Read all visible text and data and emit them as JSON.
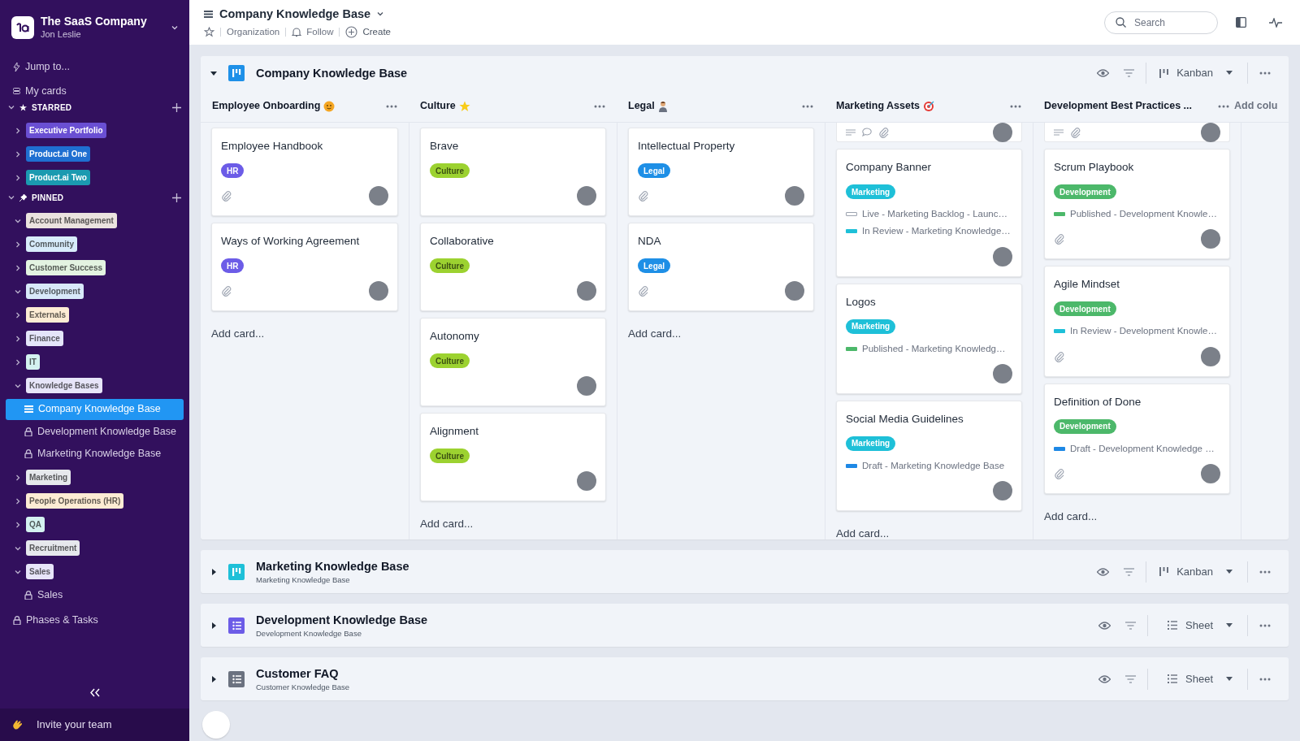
{
  "sidebar": {
    "org": "The SaaS Company",
    "user": "Jon Leslie",
    "nav": [
      {
        "label": "Jump to...",
        "kind": "jump"
      },
      {
        "label": "My cards",
        "kind": "cards"
      }
    ],
    "groups": [
      {
        "title": "STARRED",
        "kind": "star",
        "expanded": true,
        "items": [
          {
            "label": "Executive Portfolio",
            "color": "#6a4fd3",
            "expanded": false
          },
          {
            "label": "Product.ai One",
            "color": "#1f6fd1",
            "expanded": false
          },
          {
            "label": "Product.ai Two",
            "color": "#1b9ab0",
            "expanded": false
          }
        ]
      },
      {
        "title": "PINNED",
        "kind": "pin",
        "expanded": true,
        "items": [
          {
            "label": "Account Management",
            "color": "#ebe3df",
            "expanded": true
          },
          {
            "label": "Community",
            "color": "#d8ecfb",
            "expanded": false
          },
          {
            "label": "Customer Success",
            "color": "#e3f3e1",
            "expanded": false
          },
          {
            "label": "Development",
            "color": "#d8e9f9",
            "expanded": true
          },
          {
            "label": "Externals",
            "color": "#fdecd4",
            "expanded": false
          },
          {
            "label": "Finance",
            "color": "#e4e5f9",
            "expanded": false
          },
          {
            "label": "IT",
            "color": "#d4f2f0",
            "expanded": false
          },
          {
            "label": "Knowledge Bases",
            "color": "#e7e5f9",
            "expanded": true,
            "children": [
              {
                "label": "Company Knowledge Base",
                "kind": "list",
                "selected": true
              },
              {
                "label": "Development Knowledge Base",
                "kind": "locked",
                "selected": false
              },
              {
                "label": "Marketing Knowledge Base",
                "kind": "locked",
                "selected": false
              }
            ]
          },
          {
            "label": "Marketing",
            "color": "#e6e8ec",
            "expanded": false
          },
          {
            "label": "People Operations (HR)",
            "color": "#fdecd4",
            "expanded": false
          },
          {
            "label": "QA",
            "color": "#d4f2f0",
            "expanded": false
          },
          {
            "label": "Recruitment",
            "color": "#e6e8ec",
            "expanded": true
          },
          {
            "label": "Sales",
            "color": "#e7e5f9",
            "expanded": true,
            "children": [
              {
                "label": "Sales",
                "kind": "locked",
                "selected": false
              }
            ]
          }
        ]
      }
    ],
    "extra_items": [
      {
        "label": "Phases & Tasks",
        "kind": "locked",
        "selected": false
      }
    ],
    "invite": "Invite your team"
  },
  "header": {
    "title": "Company Knowledge Base",
    "actions": [
      {
        "label": "Organization",
        "kind": "org"
      },
      {
        "label": "Follow",
        "kind": "follow"
      },
      {
        "label": "Create",
        "kind": "create"
      }
    ],
    "search": {
      "placeholder": "Search"
    }
  },
  "sections": [
    {
      "title": "Company Knowledge Base",
      "kind": "kanban",
      "expanded": true,
      "color": "#1e90e8",
      "view": "Kanban",
      "columns": [
        {
          "title": "Employee Onboarding",
          "scrolled": false,
          "add": "Add card...",
          "cards": [
            {
              "title": "Employee Handbook",
              "tag": {
                "label": "HR",
                "color": "#6c5ce7"
              },
              "attachment": true
            },
            {
              "title": "Ways of Working Agreement",
              "tag": {
                "label": "HR",
                "color": "#6c5ce7"
              },
              "attachment": true
            }
          ]
        },
        {
          "title": "Culture",
          "scrolled": false,
          "add": "Add card...",
          "cards": [
            {
              "title": "Brave",
              "tag": {
                "label": "Culture",
                "color": "#9cd230"
              },
              "attachment": false
            },
            {
              "title": "Collaborative",
              "tag": {
                "label": "Culture",
                "color": "#9cd230"
              },
              "attachment": false
            },
            {
              "title": "Autonomy",
              "tag": {
                "label": "Culture",
                "color": "#9cd230"
              },
              "attachment": false
            },
            {
              "title": "Alignment",
              "tag": {
                "label": "Culture",
                "color": "#9cd230"
              },
              "attachment": false
            }
          ]
        },
        {
          "title": "Legal",
          "scrolled": false,
          "add": "Add card...",
          "cards": [
            {
              "title": "Intellectual Property",
              "tag": {
                "label": "Legal",
                "color": "#1e8fe6"
              },
              "attachment": true
            },
            {
              "title": "NDA",
              "tag": {
                "label": "Legal",
                "color": "#1e8fe6"
              },
              "attachment": true
            }
          ]
        },
        {
          "title": "Marketing Assets",
          "scrolled": true,
          "add": "Add card...",
          "cards": [
            {
              "title": "Company Banner",
              "tag": {
                "label": "Marketing",
                "color": "#1ec0d8"
              },
              "attachment": false,
              "links": [
                {
                  "text": "Live - Marketing Backlog - Launc…",
                  "kind": "outline",
                  "color": "#9ca3af"
                },
                {
                  "text": "In Review - Marketing Knowledge…",
                  "kind": "solid",
                  "color": "#1ec0d8"
                }
              ]
            },
            {
              "title": "Logos",
              "tag": {
                "label": "Marketing",
                "color": "#1ec0d8"
              },
              "attachment": false,
              "links": [
                {
                  "text": "Published - Marketing Knowledg…",
                  "kind": "solid",
                  "color": "#4cb86a"
                }
              ]
            },
            {
              "title": "Social Media Guidelines",
              "tag": {
                "label": "Marketing",
                "color": "#1ec0d8"
              },
              "attachment": false,
              "links": [
                {
                  "text": "Draft - Marketing Knowledge Base",
                  "kind": "solid",
                  "color": "#1e88e5"
                }
              ]
            }
          ]
        },
        {
          "title": "Development Best Practices ...",
          "scrolled": true,
          "add": "Add card...",
          "cards": [
            {
              "title": "Scrum Playbook",
              "tag": {
                "label": "Development",
                "color": "#4cb86a"
              },
              "attachment": true,
              "links": [
                {
                  "text": "Published - Development Knowle…",
                  "kind": "solid",
                  "color": "#4cb86a"
                }
              ]
            },
            {
              "title": "Agile Mindset",
              "tag": {
                "label": "Development",
                "color": "#4cb86a"
              },
              "attachment": true,
              "links": [
                {
                  "text": "In Review - Development Knowle…",
                  "kind": "solid",
                  "color": "#1ec0d8"
                }
              ]
            },
            {
              "title": "Definition of Done",
              "tag": {
                "label": "Development",
                "color": "#4cb86a"
              },
              "attachment": true,
              "links": [
                {
                  "text": "Draft - Development Knowledge …",
                  "kind": "solid",
                  "color": "#1e88e5"
                }
              ]
            }
          ]
        }
      ],
      "add_column": "Add colu"
    },
    {
      "title": "Marketing Knowledge Base",
      "subtitle": "Marketing Knowledge Base",
      "kind": "kanban",
      "expanded": false,
      "color": "#1ec0d8",
      "view": "Kanban"
    },
    {
      "title": "Development Knowledge Base",
      "subtitle": "Development Knowledge Base",
      "kind": "sheet",
      "expanded": false,
      "color": "#6c5ce7",
      "view": "Sheet"
    },
    {
      "title": "Customer FAQ",
      "subtitle": "Customer Knowledge Base",
      "kind": "sheet",
      "expanded": false,
      "color": "#6b7280",
      "view": "Sheet"
    }
  ]
}
